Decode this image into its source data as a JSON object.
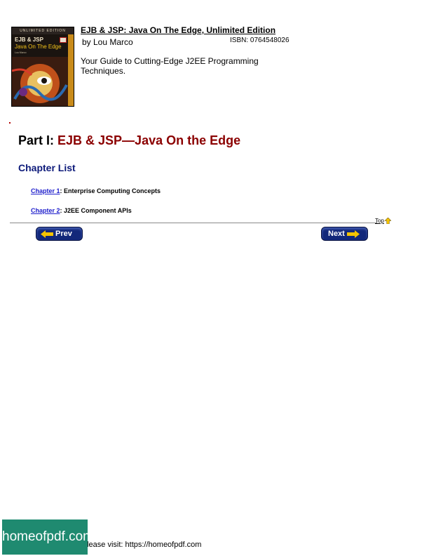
{
  "book": {
    "title": "EJB & JSP: Java On The Edge, Unlimited Edition",
    "author": "by Lou Marco",
    "isbn": "ISBN: 0764548026",
    "description": "Your Guide to Cutting-Edge J2EE Programming Techniques.",
    "cover": {
      "edition_band": "UNLIMITED EDITION",
      "title_line1": "EJB & JSP",
      "title_line2": "Java On The Edge",
      "author_line": "Lou Marco"
    }
  },
  "part": {
    "prefix": "Part I: ",
    "title": "EJB & JSP—Java On the Edge"
  },
  "chapter_list_heading": "Chapter List",
  "chapters": [
    {
      "link": "Chapter 1",
      "title": ": Enterprise Computing Concepts"
    },
    {
      "link": "Chapter 2",
      "title": ": J2EE Component APIs"
    }
  ],
  "nav": {
    "top_label": "Top",
    "prev_label": "Prev",
    "next_label": "Next"
  },
  "footer": {
    "text": "please visit: https://homeofpdf.com",
    "watermark": "homeofpdf.com"
  },
  "colors": {
    "accent_red": "#8b0000",
    "heading_blue": "#0d1a7a",
    "link_blue": "#2020cc",
    "button_navy": "#12287a",
    "watermark_green": "#1f8a70"
  }
}
